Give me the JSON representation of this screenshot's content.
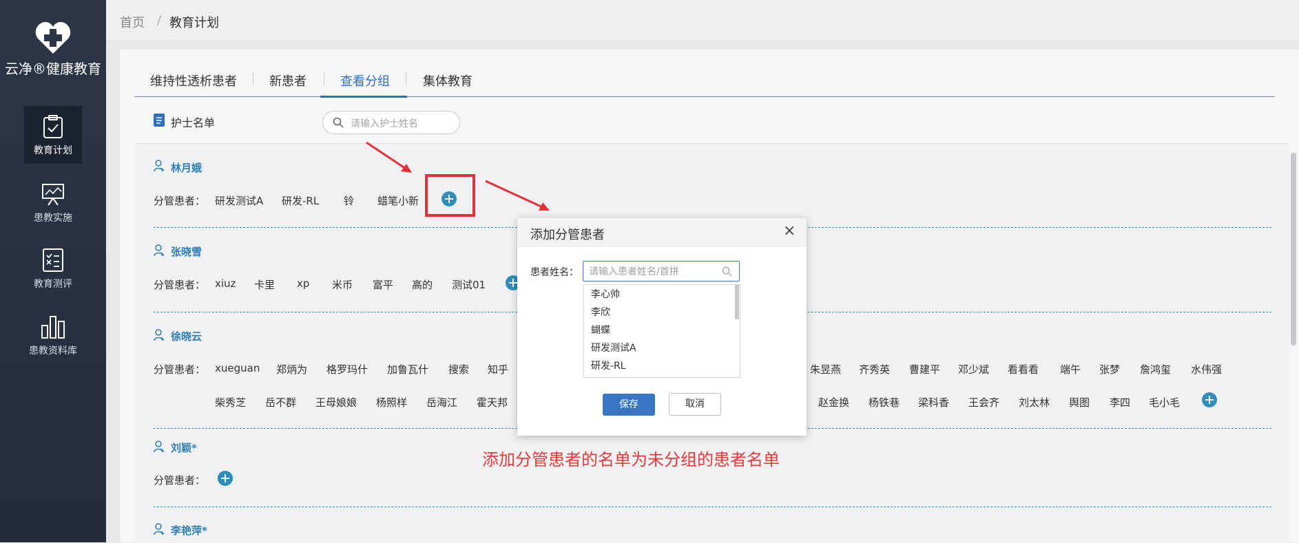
{
  "sidebar": {
    "brand": "云净®健康教育",
    "items": [
      {
        "label": "教育计划",
        "icon": "clipboard-check-icon",
        "active": true
      },
      {
        "label": "患教实施",
        "icon": "presentation-board-icon"
      },
      {
        "label": "教育测评",
        "icon": "checklist-icon"
      },
      {
        "label": "患教资料库",
        "icon": "bar-chart-icon"
      }
    ]
  },
  "breadcrumb": {
    "home": "首页",
    "separator": "/",
    "current": "教育计划"
  },
  "tabs": [
    {
      "label": "维持性透析患者"
    },
    {
      "label": "新患者"
    },
    {
      "label": "查看分组",
      "active": true
    },
    {
      "label": "集体教育"
    }
  ],
  "nurse_list": {
    "title": "护士名单",
    "search_placeholder": "请输入护士姓名"
  },
  "assigned_label": "分管患者：",
  "nurses": [
    {
      "name": "林月娥",
      "patients": [
        "研发测试A",
        "研发-RL",
        "铃",
        "蜡笔小新"
      ]
    },
    {
      "name": "张晓雪",
      "patients": [
        "xiuz",
        "卡里",
        "xp",
        "米币",
        "富平",
        "高的",
        "测试01"
      ]
    },
    {
      "name": "徐晓云",
      "row1_left": [
        "xueguan",
        "郑炳为",
        "格罗玛什",
        "加鲁瓦什",
        "搜索",
        "知乎"
      ],
      "row1_right": [
        "朱昱燕",
        "齐秀英",
        "曹建平",
        "邓少斌",
        "看看看",
        "端午",
        "张梦",
        "詹鸿玺",
        "水伟强"
      ],
      "row2_left": [
        "柴秀芝",
        "岳不群",
        "王母娘娘",
        "杨照样",
        "岳海江",
        "霍天邦"
      ],
      "row2_right": [
        "赵金换",
        "杨铁巷",
        "梁科香",
        "王会齐",
        "刘太林",
        "舆图",
        "李四",
        "毛小毛"
      ]
    },
    {
      "name": "刘颖*",
      "patients": []
    },
    {
      "name": "李艳萍*",
      "patients": []
    }
  ],
  "modal": {
    "title": "添加分管患者",
    "close": "×",
    "field_label": "患者姓名：",
    "placeholder": "请输入患者姓名/首拼",
    "options": [
      "李心帅",
      "李欣",
      "蝴蝶",
      "研发测试A",
      "研发-RL"
    ],
    "save": "保存",
    "cancel": "取消"
  },
  "annotation": "添加分管患者的名单为未分组的患者名单",
  "colors": {
    "sidebar": "#2c3647",
    "accent": "#2f6ec0",
    "nurse_name": "#2f7fb6",
    "annotation": "#e53b3b"
  }
}
